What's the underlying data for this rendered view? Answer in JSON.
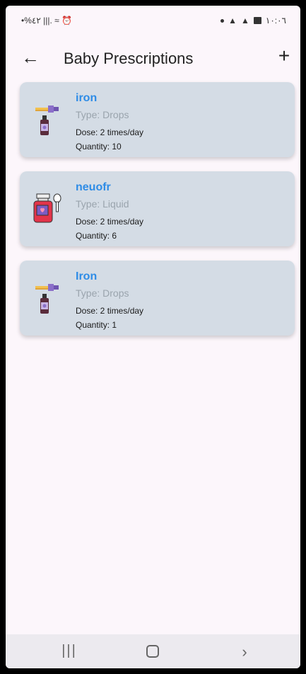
{
  "status_bar": {
    "left": "•%٤٢ |||. ≈ ⏰",
    "time": "١٠:٠٦"
  },
  "header": {
    "title": "Baby Prescriptions"
  },
  "prescriptions": [
    {
      "name": "iron",
      "type": "Type: Drops",
      "dose": "Dose: 2 times/day",
      "quantity": "Quantity: 10",
      "icon": "dropper-bottle-icon"
    },
    {
      "name": "neuofr",
      "type": "Type: Liquid",
      "dose": "Dose: 2 times/day",
      "quantity": "Quantity: 6",
      "icon": "syrup-bottle-icon"
    },
    {
      "name": "Iron",
      "type": "Type: Drops",
      "dose": "Dose: 2 times/day",
      "quantity": "Quantity: 1",
      "icon": "dropper-bottle-icon"
    }
  ],
  "colors": {
    "background": "#fcf6fb",
    "card": "#d4dce5",
    "name_accent": "#2e8ce6",
    "type_text": "#9aa4ad"
  }
}
